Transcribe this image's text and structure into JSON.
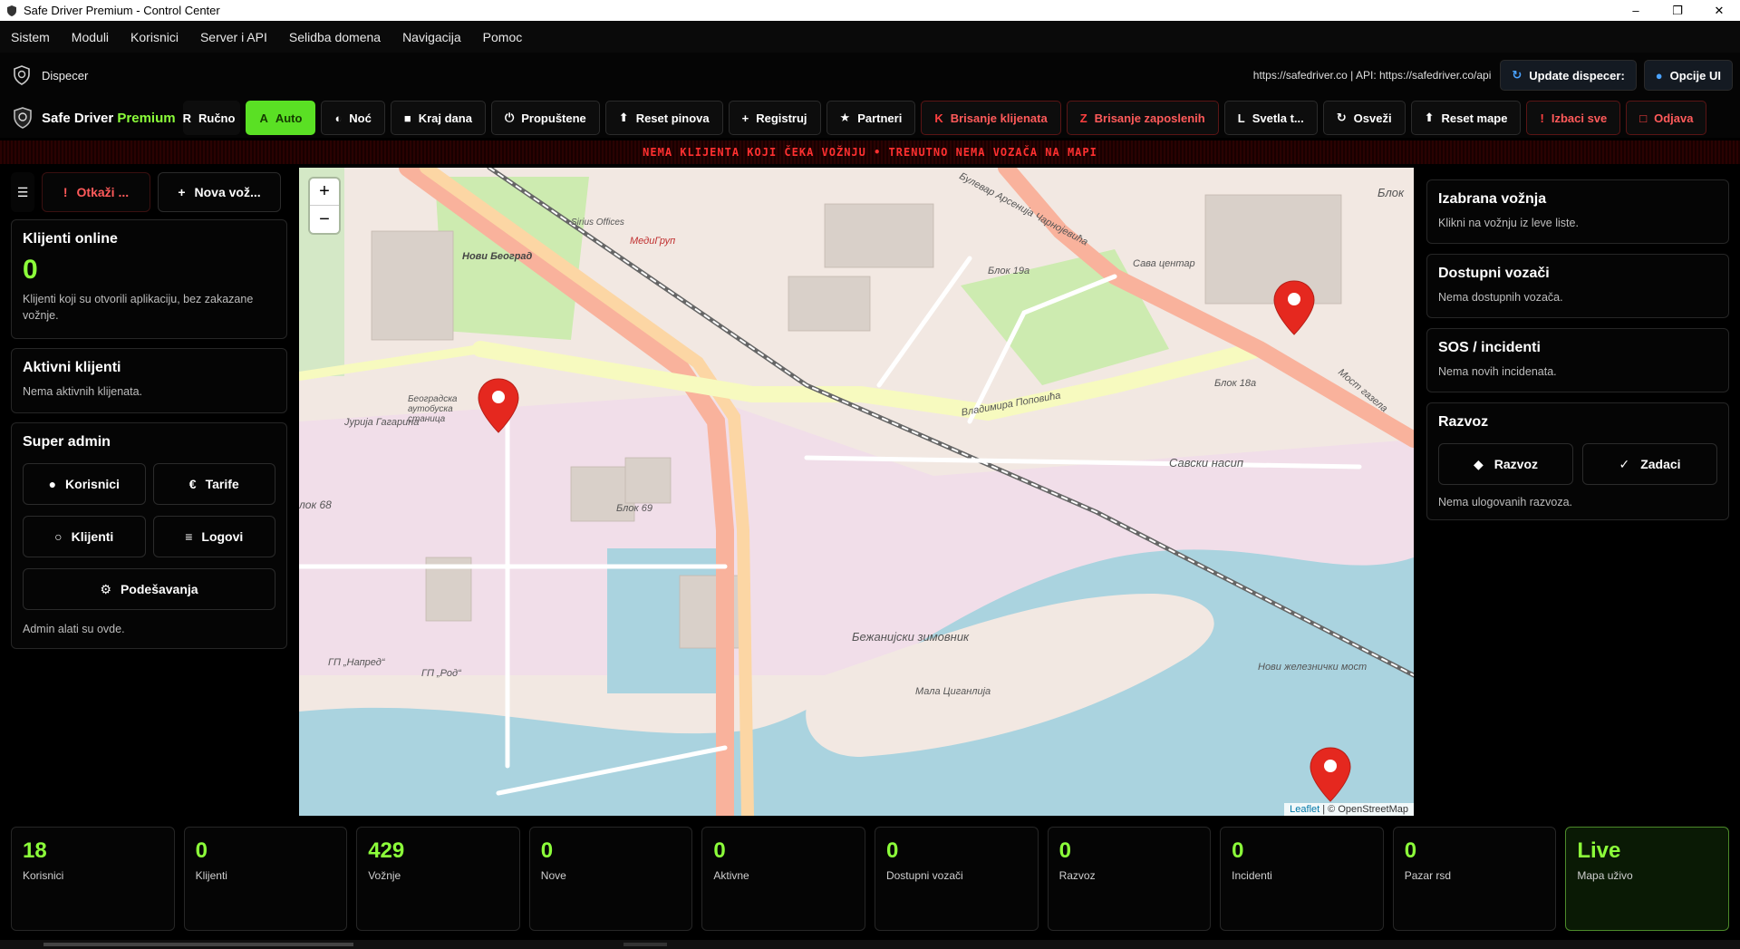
{
  "window": {
    "title": "Safe Driver Premium - Control Center",
    "minimize": "–",
    "maximize": "❐",
    "close": "✕"
  },
  "menu": [
    "Sistem",
    "Moduli",
    "Korisnici",
    "Server i API",
    "Selidba domena",
    "Navigacija",
    "Pomoc"
  ],
  "dispecer": {
    "title": "Dispecer",
    "url": "https://safedriver.co  |  API: https://safedriver.co/api",
    "update_label": "Update dispecer:",
    "options_label": "Opcije UI"
  },
  "toolbar": {
    "brand_a": "Safe Driver ",
    "brand_b": "Premium",
    "buttons": [
      {
        "icon": "R",
        "label": "Ručno"
      },
      {
        "icon": "A",
        "label": "Auto"
      },
      {
        "icon": "◐",
        "label": "Noć"
      },
      {
        "icon": "■",
        "label": "Kraj dana"
      },
      {
        "icon": "⏻",
        "label": "Propuštene"
      },
      {
        "icon": "⬆",
        "label": "Reset pinova"
      },
      {
        "icon": "+",
        "label": "Registruj"
      },
      {
        "icon": "★",
        "label": "Partneri"
      },
      {
        "icon": "K",
        "label": "Brisanje klijenata"
      },
      {
        "icon": "Z",
        "label": "Brisanje zaposlenih"
      },
      {
        "icon": "L",
        "label": "Svetla t..."
      },
      {
        "icon": "↻",
        "label": "Osveži"
      },
      {
        "icon": "⬆",
        "label": "Reset mape"
      },
      {
        "icon": "!",
        "label": "Izbaci sve"
      },
      {
        "icon": "□",
        "label": "Odjava"
      }
    ]
  },
  "ticker": "NEMA KLIJENTA KOJI ČEKA VOŽNJU • TRENUTNO NEMA VOZAČA NA MAPI",
  "left": {
    "menu_icon": "☰",
    "cancel_icon": "!",
    "cancel_label": "Otkaži ...",
    "new_icon": "+",
    "new_label": "Nova vož...",
    "online": {
      "title": "Klijenti online",
      "count": "0",
      "desc": "Klijenti koji su otvorili aplikaciju, bez zakazane vožnje."
    },
    "active": {
      "title": "Aktivni klijenti",
      "desc": "Nema aktivnih klijenata."
    },
    "admin": {
      "title": "Super admin",
      "buttons": [
        {
          "icon": "●",
          "label": "Korisnici"
        },
        {
          "icon": "€",
          "label": "Tarife"
        },
        {
          "icon": "○",
          "label": "Klijenti"
        },
        {
          "icon": "≡",
          "label": "Logovi"
        }
      ],
      "settings_icon": "⚙",
      "settings_label": "Podešavanja",
      "note": "Admin alati su ovde."
    }
  },
  "map": {
    "zoom_in": "+",
    "zoom_out": "−",
    "attribution_a": "Leaflet",
    "attribution_b": " | © OpenStreetMap",
    "labels": [
      "Булевар Арсенија Чарнојевића",
      "Блок 19а",
      "Сава центар",
      "Блок 18а",
      "Владимира Поповића",
      "Савски насип",
      "Блок 69",
      "Јурија Гагарина",
      "Бежанијски зимовник",
      "Мала Циганлија",
      "Нови железнички мост",
      "Нови Београд",
      "МедиГруп",
      "ГП „Напред“",
      "ГП „Род“",
      "Београдска аутобуска станица",
      "Мост газела",
      "Блок",
      "Sirius Offices",
      "лок 68"
    ]
  },
  "right": {
    "selected": {
      "title": "Izabrana vožnja",
      "desc": "Klikni na vožnju iz leve liste."
    },
    "drivers": {
      "title": "Dostupni vozači",
      "desc": "Nema dostupnih vozača."
    },
    "sos": {
      "title": "SOS / incidenti",
      "desc": "Nema novih incidenata."
    },
    "razvoz": {
      "title": "Razvoz",
      "btn1_icon": "◆",
      "btn1": "Razvoz",
      "btn2_icon": "✓",
      "btn2": "Zadaci",
      "desc": "Nema ulogovanih razvoza."
    }
  },
  "stats": [
    {
      "num": "18",
      "label": "Korisnici"
    },
    {
      "num": "0",
      "label": "Klijenti"
    },
    {
      "num": "429",
      "label": "Vožnje"
    },
    {
      "num": "0",
      "label": "Nove"
    },
    {
      "num": "0",
      "label": "Aktivne"
    },
    {
      "num": "0",
      "label": "Dostupni vozači"
    },
    {
      "num": "0",
      "label": "Razvoz"
    },
    {
      "num": "0",
      "label": "Incidenti"
    },
    {
      "num": "0",
      "label": "Pazar rsd"
    },
    {
      "num": "Live",
      "label": "Mapa uživo"
    }
  ],
  "colors": {
    "accent": "#8cff3a",
    "danger": "#ff4040",
    "map_water": "#aad3df",
    "map_land": "#f2dfe9"
  }
}
